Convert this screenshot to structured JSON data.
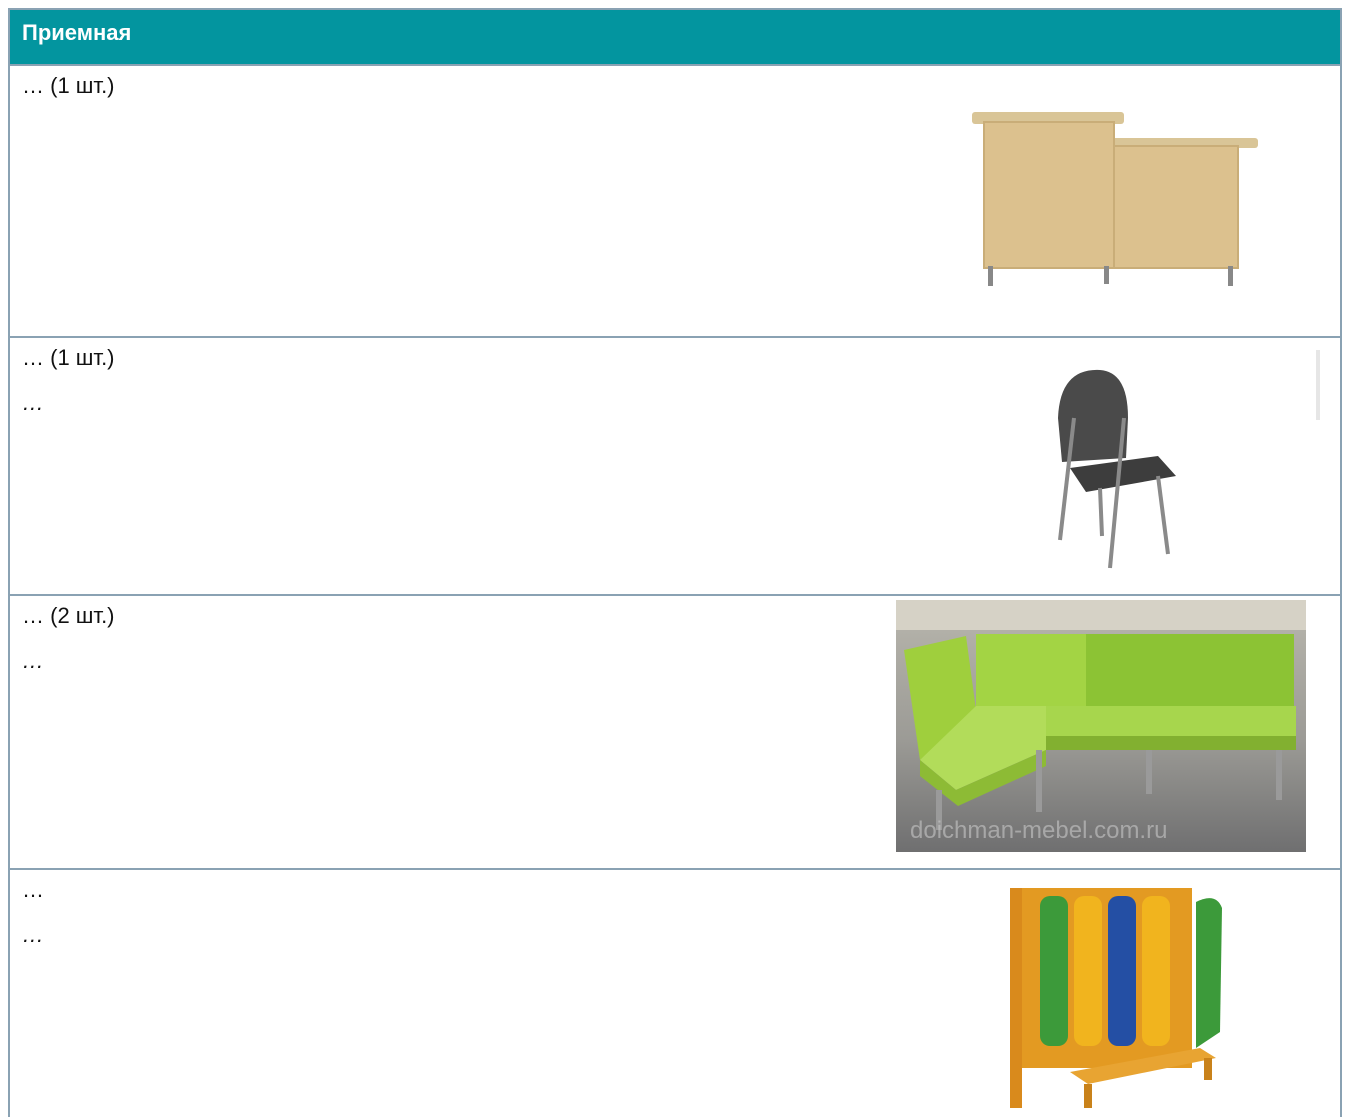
{
  "header": {
    "title": "Приемная"
  },
  "rows": [
    {
      "title": "… (1 шт.)",
      "note": "",
      "image": "reception-desk"
    },
    {
      "title": "… (1 шт.)",
      "note": "…",
      "image": "chair"
    },
    {
      "title": "… (2 шт.)",
      "note": "…",
      "image": "green-corner-sofa",
      "watermark": "doichman-mebel.com.ru"
    },
    {
      "title": "…",
      "note": "…",
      "image": "kids-locker-with-bench"
    }
  ],
  "colors": {
    "header_bg": "#03959f",
    "border": "#8aa2b3"
  }
}
